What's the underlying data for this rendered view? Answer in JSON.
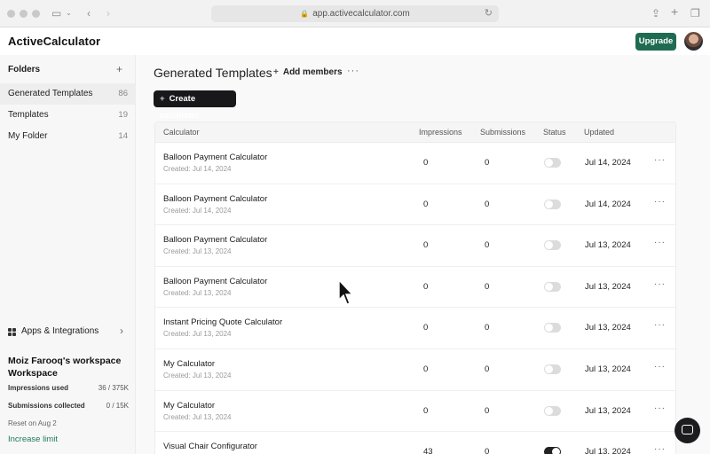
{
  "browser": {
    "url": "app.activecalculator.com"
  },
  "app": {
    "logo": "ActiveCalculator",
    "upgrade_label": "Upgrade"
  },
  "sidebar": {
    "folders_title": "Folders",
    "items": [
      {
        "label": "Generated Templates",
        "count": "86"
      },
      {
        "label": "Templates",
        "count": "19"
      },
      {
        "label": "My Folder",
        "count": "14"
      }
    ],
    "apps_label": "Apps & Integrations",
    "workspace_owner": "Moiz Farooq's workspace",
    "workspace_label": "Workspace",
    "impressions_label": "Impressions used",
    "impressions_value": "36 / 375K",
    "submissions_label": "Submissions collected",
    "submissions_value": "0 / 15K",
    "reset_text": "Reset on Aug 2",
    "increase_limit": "Increase limit"
  },
  "main": {
    "title": "Generated Templates",
    "add_members": "Add members",
    "create_label": "Create calculator",
    "columns": {
      "calculator": "Calculator",
      "impressions": "Impressions",
      "submissions": "Submissions",
      "status": "Status",
      "updated": "Updated"
    },
    "rows": [
      {
        "name": "Balloon Payment Calculator",
        "created": "Created: Jul 14, 2024",
        "impressions": "0",
        "submissions": "0",
        "status_on": false,
        "updated": "Jul 14, 2024"
      },
      {
        "name": "Balloon Payment Calculator",
        "created": "Created: Jul 14, 2024",
        "impressions": "0",
        "submissions": "0",
        "status_on": false,
        "updated": "Jul 14, 2024"
      },
      {
        "name": "Balloon Payment Calculator",
        "created": "Created: Jul 13, 2024",
        "impressions": "0",
        "submissions": "0",
        "status_on": false,
        "updated": "Jul 13, 2024"
      },
      {
        "name": "Balloon Payment Calculator",
        "created": "Created: Jul 13, 2024",
        "impressions": "0",
        "submissions": "0",
        "status_on": false,
        "updated": "Jul 13, 2024"
      },
      {
        "name": "Instant Pricing Quote Calculator",
        "created": "Created: Jul 13, 2024",
        "impressions": "0",
        "submissions": "0",
        "status_on": false,
        "updated": "Jul 13, 2024"
      },
      {
        "name": "My Calculator",
        "created": "Created: Jul 13, 2024",
        "impressions": "0",
        "submissions": "0",
        "status_on": false,
        "updated": "Jul 13, 2024"
      },
      {
        "name": "My Calculator",
        "created": "Created: Jul 13, 2024",
        "impressions": "0",
        "submissions": "0",
        "status_on": false,
        "updated": "Jul 13, 2024"
      },
      {
        "name": "Visual Chair Configurator",
        "created": "",
        "impressions": "43",
        "submissions": "0",
        "status_on": true,
        "updated": "Jul 13, 2024"
      }
    ]
  },
  "colors": {
    "brand_green": "#1f6b52",
    "link_green": "#1f7a5a",
    "primary_dark": "#18181b"
  }
}
